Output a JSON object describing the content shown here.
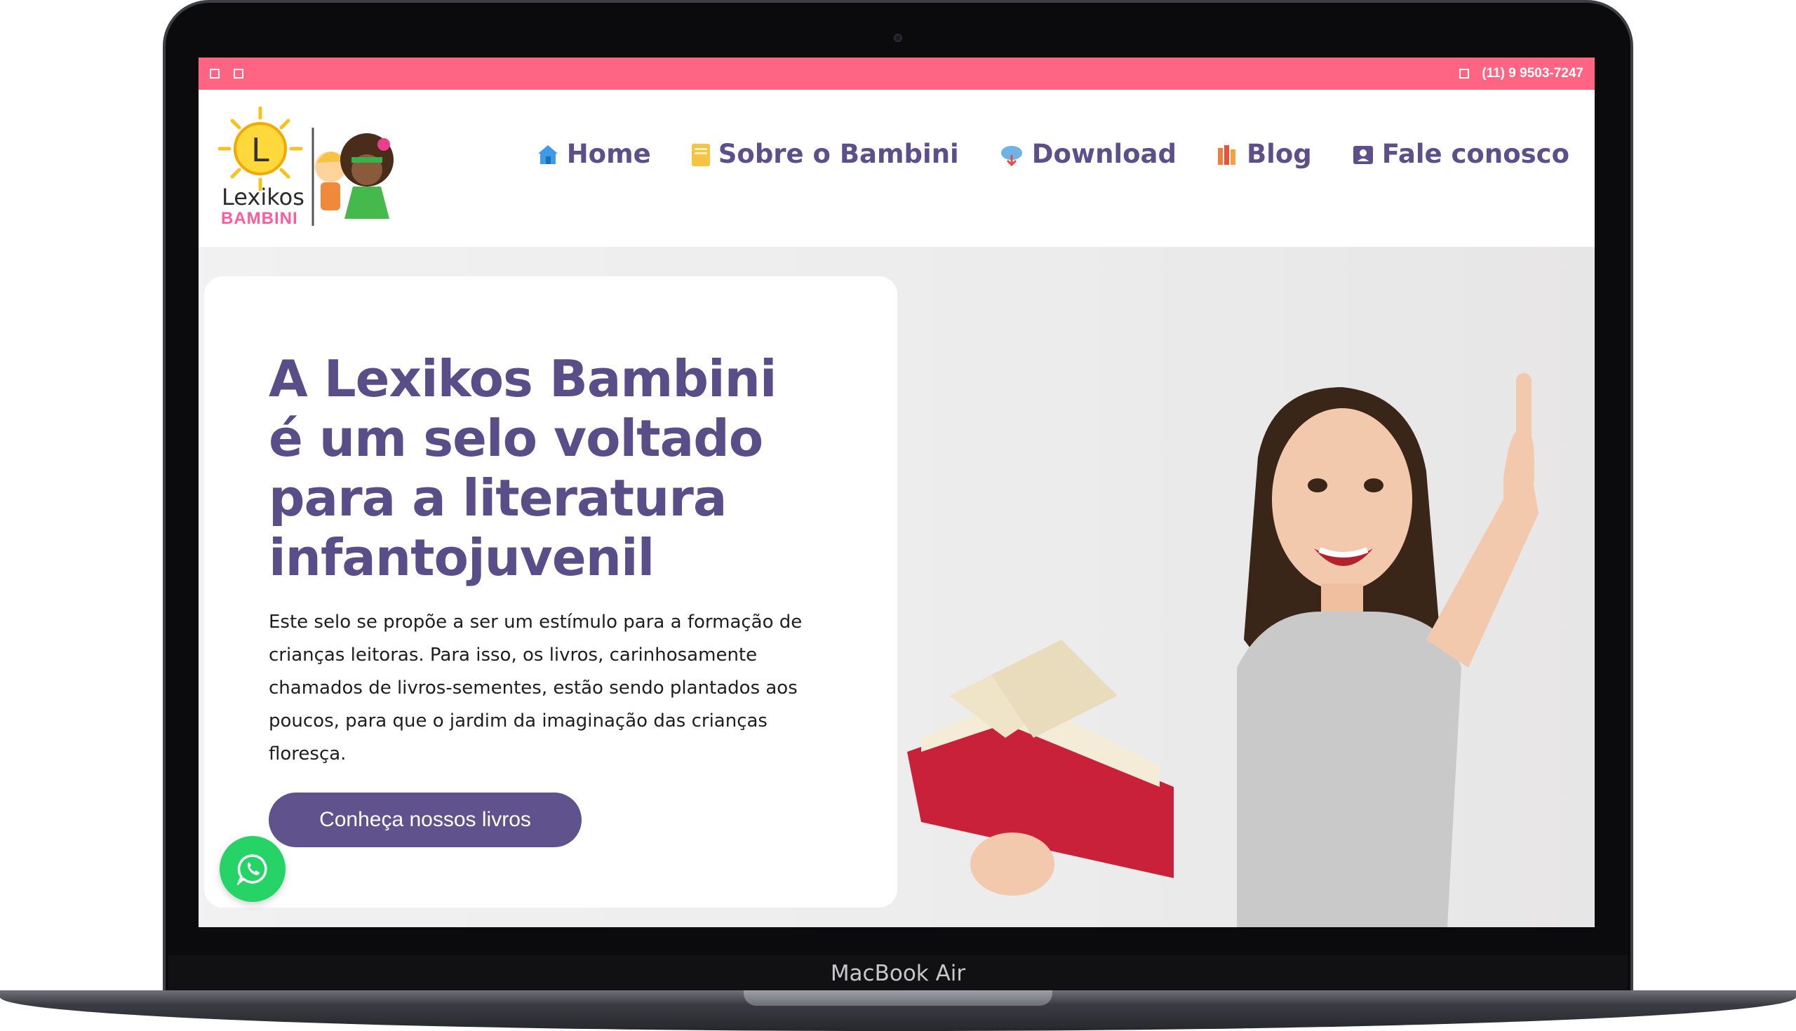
{
  "device": {
    "model_label": "MacBook Air"
  },
  "topbar": {
    "phone": "(11) 9 9503-7247",
    "icons": [
      "square-icon",
      "square-icon"
    ]
  },
  "brand": {
    "logo_text": "Lexikos",
    "logo_sub": "BAMBINI"
  },
  "nav": {
    "items": [
      {
        "label": "Home",
        "icon": "house-icon",
        "icon_color": "#3d9be9"
      },
      {
        "label": "Sobre o Bambini",
        "icon": "notepad-icon",
        "icon_color": "#f6c343"
      },
      {
        "label": "Download",
        "icon": "cloud-download-icon",
        "icon_color": "#6fb3e6"
      },
      {
        "label": "Blog",
        "icon": "books-icon",
        "icon_color": "#f07f3a"
      },
      {
        "label": "Fale conosco",
        "icon": "contact-card-icon",
        "icon_color": "#5c4f8a"
      }
    ]
  },
  "hero": {
    "title": "A Lexikos Bambini é um selo voltado para a literatura infantojuvenil",
    "description": "Este selo se propõe a ser um estímulo para a formação de crianças leitoras. Para isso, os livros, carinhosamente chamados de livros-sementes, estão sendo plantados aos poucos, para que o jardim da imaginação das crianças floresça.",
    "cta_label": "Conheça nossos livros"
  },
  "colors": {
    "topbar": "#ff6482",
    "nav_text": "#5c4f8a",
    "title": "#5a4e89",
    "cta": "#5f528d",
    "whatsapp": "#25d366"
  }
}
